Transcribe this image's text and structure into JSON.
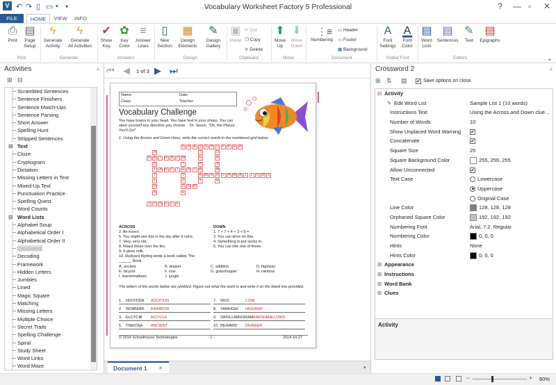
{
  "app": {
    "title": "Vocabulary Worksheet Factory 5 Professional"
  },
  "tabs": {
    "file": "FILE",
    "home": "HOME",
    "view": "VIEW",
    "info": "INFO"
  },
  "ribbon": {
    "print": "Print",
    "page_setup_1": "Page",
    "page_setup_2": "Setup",
    "gen_act_1": "Generate",
    "gen_act_2": "Activity",
    "gen_all_1": "Generate",
    "gen_all_2": "All Activities",
    "show_key_1": "Show",
    "show_key_2": "Key",
    "key_color_1": "Key",
    "key_color_2": "Color",
    "answer_lines_1": "Answer",
    "answer_lines_2": "Lines",
    "new_section_1": "New",
    "new_section_2": "Section",
    "design_elements_1": "Design",
    "design_elements_2": "Elements",
    "design_gallery_1": "Design",
    "design_gallery_2": "Gallery",
    "paste": "Paste",
    "cut": "Cut",
    "copy": "Copy",
    "delete": "Delete",
    "move_up_1": "Move",
    "move_up_2": "Up",
    "move_down_1": "Move",
    "move_down_2": "Down",
    "numbering": "Numbering",
    "header": "Header",
    "footer": "Footer",
    "background": "Background",
    "font_settings_1": "Font",
    "font_settings_2": "Settings",
    "font_color_1": "Font",
    "font_color_2": "Color",
    "word_lists_1": "Word",
    "word_lists_2": "Lists",
    "sentences": "Sentences",
    "text": "Text",
    "epigraphs": "Epigraphs",
    "groups": {
      "print": "Print",
      "generate": "Generate",
      "answers": "Answers",
      "design": "Design",
      "clipboard": "Clipboard",
      "move": "Move",
      "document": "Document",
      "global_font": "Global Font",
      "editors": "Editors"
    }
  },
  "left": {
    "title": "Activities",
    "tree": [
      {
        "t": "item",
        "label": "Scrambled Sentences"
      },
      {
        "t": "item",
        "label": "Sentence Finishers"
      },
      {
        "t": "item",
        "label": "Sentence Match-Ups"
      },
      {
        "t": "item",
        "label": "Sentence Parsing"
      },
      {
        "t": "item",
        "label": "Short Answer"
      },
      {
        "t": "item",
        "label": "Spelling Hunt"
      },
      {
        "t": "item",
        "label": "Stripped Sentences"
      },
      {
        "t": "cat",
        "label": "Text"
      },
      {
        "t": "item",
        "label": "Cloze"
      },
      {
        "t": "item",
        "label": "Cryptogram"
      },
      {
        "t": "item",
        "label": "Dictation"
      },
      {
        "t": "item",
        "label": "Missing Letters in Text"
      },
      {
        "t": "item",
        "label": "Mixed-Up Text"
      },
      {
        "t": "item",
        "label": "Punctuation Practice"
      },
      {
        "t": "item",
        "label": "Spelling Quest"
      },
      {
        "t": "item",
        "label": "Word Counts"
      },
      {
        "t": "cat",
        "label": "Word Lists"
      },
      {
        "t": "item",
        "label": "Alphabet Soup"
      },
      {
        "t": "item",
        "label": "Alphabetical Order I"
      },
      {
        "t": "item",
        "label": "Alphabetical Order II"
      },
      {
        "t": "sel",
        "label": "Crossword"
      },
      {
        "t": "item",
        "label": "Decoding"
      },
      {
        "t": "item",
        "label": "Framework"
      },
      {
        "t": "item",
        "label": "Hidden Letters"
      },
      {
        "t": "item",
        "label": "Jumbles"
      },
      {
        "t": "item",
        "label": "Lined"
      },
      {
        "t": "item",
        "label": "Magic Square"
      },
      {
        "t": "item",
        "label": "Matching"
      },
      {
        "t": "item",
        "label": "Missing Letters"
      },
      {
        "t": "item",
        "label": "Multiple Choice"
      },
      {
        "t": "item",
        "label": "Secret Trails"
      },
      {
        "t": "item",
        "label": "Spelling Challenge"
      },
      {
        "t": "item",
        "label": "Spiral"
      },
      {
        "t": "item",
        "label": "Study Sheet"
      },
      {
        "t": "item",
        "label": "Word Links"
      },
      {
        "t": "item",
        "label": "Word Maze"
      }
    ]
  },
  "nav": {
    "page": "1 of 3"
  },
  "worksheet": {
    "name": "Name:",
    "date": "Date:",
    "class": "Class:",
    "teacher": "Teacher:",
    "title": "Vocabulary Challenge",
    "quote": "You have brains in your head. You have feet in your shoes. You can steer yourself any direction you choose. - Dr. Seuss, \"Oh, the Places You'll Go!\"",
    "instr1": "1.   Using the Across and Down clues, write the correct words in the numbered grid below.",
    "across_h": "ACROSS",
    "down_h": "DOWN",
    "across": [
      "2.   An insect.",
      "5.   You might see this in the sky after it rains.",
      "7.   Very, very old.",
      "8.   Roast these over the fire.",
      "9.   It gives milk.",
      "10.  Rudyard Kipling wrote a book called, The ______ Book."
    ],
    "down": [
      "1.   7 + 7 + 4 + 3 + 9 =",
      "3.   You can drive on this.",
      "4.   Something to put socks in.",
      "6.   You can ride one of these."
    ],
    "bank": [
      "A.  ancient",
      "B.  drawer",
      "C.  addition",
      "D.  highway",
      "E.  bicycle",
      "F.  cow",
      "G.  grasshopper",
      "H.  rainbow",
      "I.   marshmallows",
      "J.  jungle"
    ],
    "instr2": "The letters of the words below are jumbled. Figure out what the word is and write it on the blank line provided.",
    "jumbles": [
      {
        "n": "1.",
        "q": "NOITIDDA",
        "a": "ADDITION"
      },
      {
        "n": "2.",
        "q": "WOBNIAR",
        "a": "RAINBOW"
      },
      {
        "n": "3.",
        "q": "ELCYCIB",
        "a": "BICYCLE"
      },
      {
        "n": "5.",
        "q": "TNEICNA",
        "a": "ANCIENT"
      },
      {
        "n": "7.",
        "q": "WOC",
        "a": "COW"
      },
      {
        "n": "8.",
        "q": "YAWHGIH",
        "a": "HIGHWAY"
      },
      {
        "n": "9.",
        "q": "SWOLLAMHSRAM",
        "a": "MARSHMALLOWS"
      },
      {
        "n": "10.",
        "q": "REWARD",
        "a": "DRAWER"
      }
    ],
    "footer_left": "© 2014 Schoolhouse Technologies",
    "footer_mid": "- 1 -",
    "footer_right": "2014-10-27"
  },
  "grid": {
    "words": [
      {
        "w": "GRASSHOPPER",
        "r": 0,
        "c": 6,
        "d": "a"
      },
      {
        "w": "RAINBOW",
        "r": 2,
        "c": 0,
        "d": "a"
      },
      {
        "w": "ANCIENT",
        "r": 4,
        "c": 2,
        "d": "a"
      },
      {
        "w": "MARSHMALLOWS",
        "r": 5,
        "c": 10,
        "d": "a"
      },
      {
        "w": "COW",
        "r": 7,
        "c": 6,
        "d": "a"
      },
      {
        "w": "JUNGLE",
        "r": 10,
        "c": 0,
        "d": "a"
      },
      {
        "w": "ADDITION",
        "r": 1,
        "c": 1,
        "d": "d"
      },
      {
        "w": "HIGHWAY",
        "r": 0,
        "c": 9,
        "d": "d"
      },
      {
        "w": "DRAWER",
        "r": 1,
        "c": 12,
        "d": "d"
      },
      {
        "w": "BICYCLE",
        "r": 2,
        "c": 6,
        "d": "d"
      }
    ]
  },
  "doc": {
    "tab": "Document 1"
  },
  "right": {
    "title": "Crossword 2",
    "save_opt": "Save options on close.",
    "activity": "Activity",
    "rows": [
      {
        "k": "Edit Word List",
        "v": "Sample List 1 (10 words)",
        "type": "text"
      },
      {
        "k": "Instructions Text",
        "v": "Using the Across and Down clue...",
        "type": "text"
      },
      {
        "k": "Number of Words",
        "v": "10",
        "type": "text"
      },
      {
        "k": "Show Unplaced Word Warning",
        "v": "",
        "type": "check"
      },
      {
        "k": "Concatenate",
        "v": "",
        "type": "check"
      },
      {
        "k": "Square Size",
        "v": "25",
        "type": "text"
      },
      {
        "k": "Square Background Color",
        "v": "255, 255, 255",
        "type": "color",
        "c": "#ffffff"
      },
      {
        "k": "Allow Unconnected",
        "v": "",
        "type": "check"
      },
      {
        "k": "Text Case",
        "v": "Lowercase",
        "type": "radio",
        "on": false
      },
      {
        "k": "",
        "v": "Uppercase",
        "type": "radio",
        "on": true
      },
      {
        "k": "",
        "v": "Original Case",
        "type": "radio",
        "on": false
      },
      {
        "k": "Line Color",
        "v": "128, 128, 128",
        "type": "color",
        "c": "#808080"
      },
      {
        "k": "Orphaned Square Color",
        "v": "192, 192, 192",
        "type": "color",
        "c": "#c0c0c0"
      },
      {
        "k": "Numbering Font",
        "v": "Arial, 7.2, Regular",
        "type": "text"
      },
      {
        "k": "Numbering Color",
        "v": "0, 0, 0",
        "type": "color",
        "c": "#000000"
      },
      {
        "k": "Hints",
        "v": "None",
        "type": "text"
      },
      {
        "k": "Hints Color",
        "v": "0, 0, 0",
        "type": "color",
        "c": "#000000"
      }
    ],
    "cats": [
      "Appearance",
      "Instructions",
      "Word Bank",
      "Clues"
    ],
    "help_title": "Activity"
  },
  "status": {
    "zoom": "60%"
  },
  "colors": {
    "accent": "#2b5797",
    "answer": "#dd2222"
  }
}
